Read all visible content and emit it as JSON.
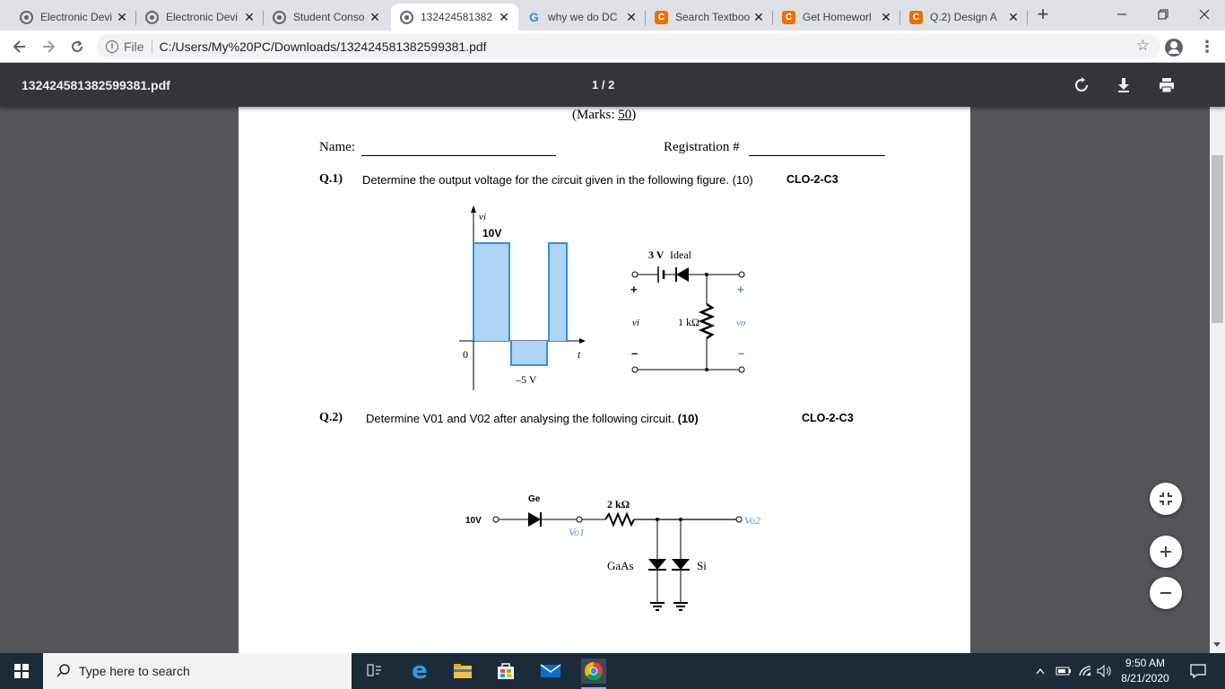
{
  "browser": {
    "tabs": [
      {
        "label": "Electronic Devi",
        "favicon": "globe-icon"
      },
      {
        "label": "Electronic Devi",
        "favicon": "globe-icon"
      },
      {
        "label": "Student Conso",
        "favicon": "globe-icon"
      },
      {
        "label": "132424581382",
        "favicon": "globe-icon",
        "active": true
      },
      {
        "label": "why we do DC",
        "favicon": "google-icon"
      },
      {
        "label": "Search Textboo",
        "favicon": "chegg-icon"
      },
      {
        "label": "Get Homeworl",
        "favicon": "chegg-icon"
      },
      {
        "label": "Q.2) Design A",
        "favicon": "chegg-icon"
      }
    ],
    "new_tab": "+",
    "address": {
      "scheme_label": "File",
      "url": "C:/Users/My%20PC/Downloads/132424581382599381.pdf"
    }
  },
  "pdf_viewer": {
    "filename": "132424581382599381.pdf",
    "page_indicator": "1 / 2"
  },
  "document": {
    "marks_prefix": "(Marks: ",
    "marks_value": "50",
    "marks_suffix": ")",
    "name_label": "Name:",
    "registration_label": "Registration #",
    "q1": {
      "number": "Q.1)",
      "text": "Determine the output voltage for the circuit given in the following figure. (10)",
      "clo": "CLO-2-C3"
    },
    "fig1": {
      "vi_axis_label": "vi",
      "peak_label": "10V",
      "neg_label": "–5 V",
      "zero_label": "0",
      "t_label": "t",
      "battery_label": "3 V",
      "ideal_label": "Ideal",
      "resistor_label": "1 kΩ",
      "vi_label": "vi",
      "vo_label": "vo",
      "plus": "+",
      "minus": "–"
    },
    "q2": {
      "number": "Q.2)",
      "text": "Determine V01 and V02 after analysing the following circuit.",
      "marks": "(10)",
      "clo": "CLO-2-C3"
    },
    "fig2": {
      "source_label": "10V",
      "diode_label": "Ge",
      "resistor_label": "2 kΩ",
      "vo1_label": "Vo1",
      "vo2_label": "Vo2",
      "gaas_label": "GaAs",
      "si_label": "Si"
    }
  },
  "taskbar": {
    "search_placeholder": "Type here to search",
    "time": "9:50 AM",
    "date": "8/21/2020"
  },
  "colors": {
    "waveform_fill": "#aed4f6",
    "waveform_stroke": "#3a8fd8",
    "vo_label": "#5aa0d8",
    "chegg": "#eb7100",
    "pdf_toolbar": "#323639"
  }
}
